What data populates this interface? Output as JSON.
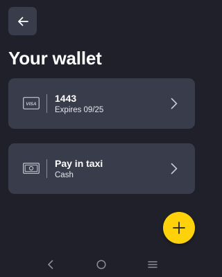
{
  "header": {
    "back_icon": "arrow-left-icon"
  },
  "title": "Your wallet",
  "payment_methods": [
    {
      "icon": "visa-card-icon",
      "icon_text": "VISA",
      "title": "1443",
      "subtitle": "Expires  09/25"
    },
    {
      "icon": "cash-icon",
      "title": "Pay in taxi",
      "subtitle": "Cash"
    }
  ],
  "fab": {
    "icon": "plus-icon",
    "color": "#fdd20a"
  },
  "system_nav": {
    "back_icon": "chevron-left-icon",
    "home_icon": "circle-home-icon",
    "menu_icon": "menu-lines-icon"
  },
  "colors": {
    "background": "#1f2029",
    "surface": "#393c4b",
    "accent": "#fdd20a",
    "text": "#ffffff"
  }
}
